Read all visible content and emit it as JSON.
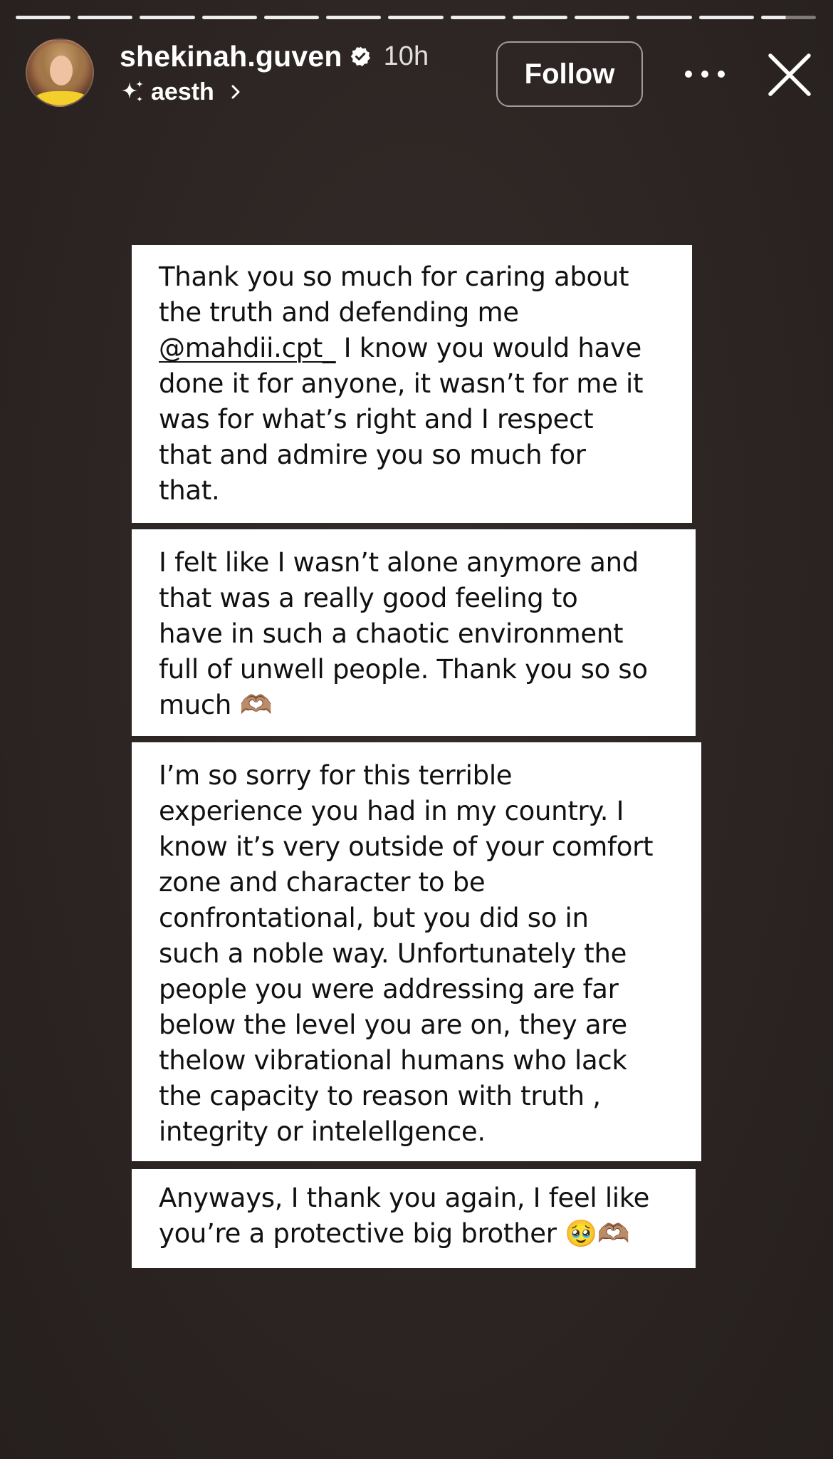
{
  "story": {
    "progress_segments": 13,
    "current_segment_progress": 0.45
  },
  "header": {
    "username": "shekinah.guven",
    "verified_icon": "verified-badge-icon",
    "timestamp": "10h",
    "music_label": "aesth",
    "follow_label": "Follow",
    "more_icon": "more-horizontal-icon",
    "close_icon": "close-icon"
  },
  "cards": [
    {
      "before_mention": "Thank you so much for caring about\nthe truth and defending me\n",
      "mention": "@mahdii.cpt_",
      "after_mention": " I know you would have\ndone it for anyone, it wasn’t for me it\nwas for what’s right and I respect\nthat and admire you so much for\nthat."
    },
    {
      "text": "I felt like I wasn’t alone anymore and\nthat was a really good feeling to\nhave in such a chaotic environment\nfull of unwell people. Thank you so so\nmuch 🫶🏽"
    },
    {
      "text": "I’m so sorry for this terrible\nexperience you had in my country. I\nknow it’s very outside of your comfort\nzone and character to be\nconfrontational, but you did so in\nsuch a noble way. Unfortunately the\npeople you were addressing are far\nbelow the level you are on, they are\nthelow vibrational humans who lack\nthe capacity to reason with truth ,\nintegrity or intelellgence."
    },
    {
      "text": "Anyways, I thank you again, I feel like\nyou’re a protective big brother 🥹🫶🏽"
    }
  ],
  "colors": {
    "background": "#2b2422",
    "card_bg": "#ffffff",
    "text": "#111111",
    "header_text": "#ffffff"
  }
}
